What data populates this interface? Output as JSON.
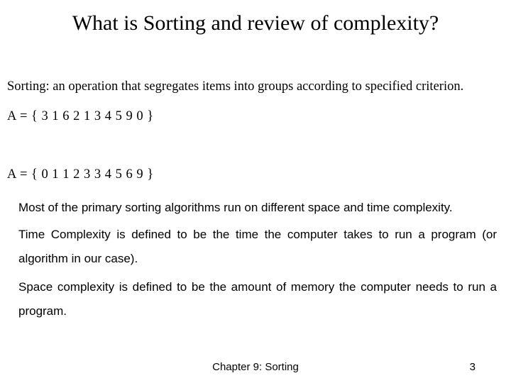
{
  "title": "What is Sorting and review of complexity?",
  "definition": "Sorting: an operation that segregates items into groups according to specified criterion.",
  "array_unsorted": "A = { 3 1 6 2 1 3 4 5 9 0 }",
  "array_sorted": "A = { 0 1 1 2 3 3 4 5 6 9 }",
  "para1": "Most of the primary sorting algorithms run on different space and time complexity.",
  "para2": "Time Complexity is defined to be the time the computer takes to run a program (or algorithm in our case).",
  "para3": "Space complexity is defined to be the amount of memory the computer needs to run a program.",
  "footer_center": "Chapter 9: Sorting",
  "footer_right": "3"
}
